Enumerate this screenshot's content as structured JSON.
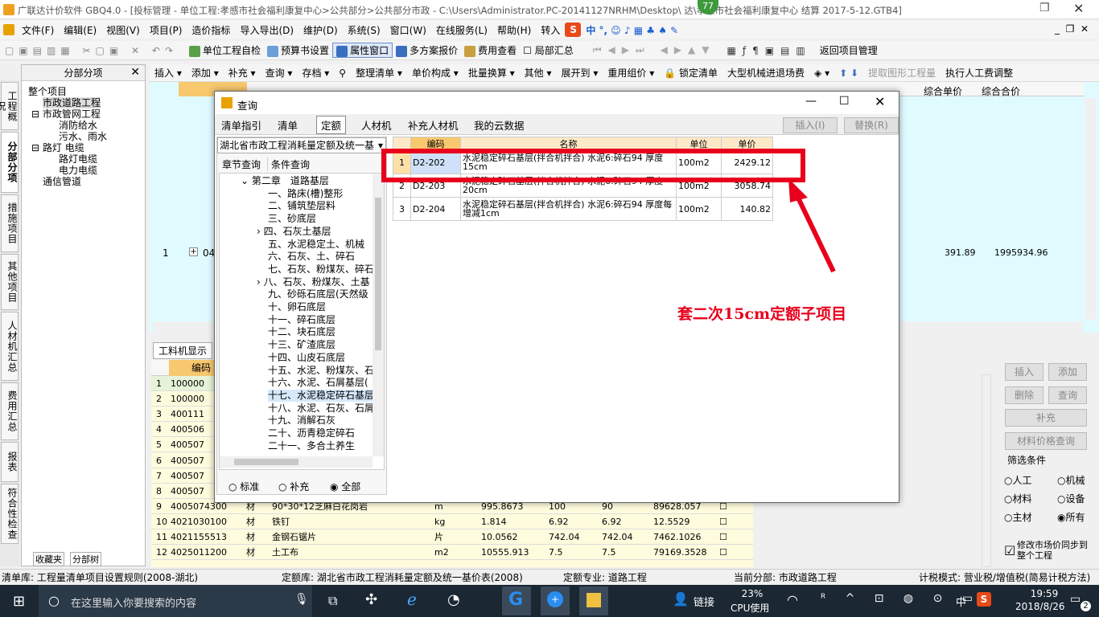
{
  "window": {
    "title": "广联达计价软件 GBQ4.0 - [投标管理 - 单位工程:孝感市社会福利康复中心>公共部分>公共部分市政 - C:\\Users\\Administrator.PC-20141127NRHM\\Desktop\\ 达\\孝感市社会福利康复中心 结算 2017-5-12.GTB4]",
    "badge": "77"
  },
  "menu": [
    "文件(F)",
    "编辑(E)",
    "视图(V)",
    "项目(P)",
    "造价指标",
    "导入导出(D)",
    "维护(D)",
    "系统(S)",
    "窗口(W)",
    "在线服务(L)",
    "帮助(H)",
    "转入"
  ],
  "toolbar1": [
    "单位工程自检",
    "预算书设置",
    "属性窗口",
    "多方案报价",
    "费用查看",
    "局部汇总",
    "返回项目管理"
  ],
  "left_tabs": [
    "工程概况",
    "分部分项",
    "措施项目",
    "其他项目",
    "人材机汇总",
    "费用汇总",
    "报表",
    "符合性检查"
  ],
  "tree": {
    "header": "分部分项",
    "nodes": [
      "整个项目",
      "市政道路工程",
      "市政管网工程",
      "消防给水",
      "污水、雨水",
      "路灯 电缆",
      "路灯电缆",
      "电力电缆",
      "通信管道"
    ],
    "footer_tabs": [
      "收藏夹",
      "分部树"
    ]
  },
  "toolbar2": [
    "插入",
    "添加",
    "补充",
    "查询",
    "存档",
    "整理清单",
    "单价构成",
    "批量换算",
    "其他",
    "展开到",
    "重用组价",
    "锁定清单",
    "大型机械进退场费",
    "提取图形工程量",
    "执行人工费调整"
  ],
  "maingrid": {
    "cols": [
      "综合单价",
      "综合合价"
    ],
    "row_no": "1",
    "code_prefix": "04(",
    "unit_price": "391.89",
    "total_price": "1995934.96"
  },
  "lower": {
    "tab": "工料机显示",
    "col_code": "编码",
    "rows": [
      [
        "1",
        "100000",
        "",
        "",
        "",
        "",
        "",
        ""
      ],
      [
        "2",
        "100000",
        "",
        "",
        "",
        "",
        "",
        ""
      ],
      [
        "3",
        "400111",
        "",
        "",
        "",
        "",
        "",
        ""
      ],
      [
        "4",
        "400506",
        "",
        "",
        "",
        "",
        "",
        ""
      ],
      [
        "5",
        "400507",
        "",
        "",
        "",
        "",
        "",
        ""
      ],
      [
        "6",
        "400507",
        "",
        "",
        "",
        "",
        "",
        ""
      ],
      [
        "7",
        "400507",
        "",
        "",
        "",
        "",
        "",
        ""
      ],
      [
        "8",
        "400507",
        "",
        "",
        "",
        "",
        "",
        ""
      ],
      [
        "9",
        "4005074300",
        "材",
        "90*30*12芝麻白花岗岩",
        "m",
        "995.8673",
        "100",
        "90",
        "89628.057"
      ],
      [
        "10",
        "4021030100",
        "材",
        "铁钉",
        "kg",
        "1.814",
        "6.92",
        "6.92",
        "12.5529"
      ],
      [
        "11",
        "4021155513",
        "材",
        "金钢石锯片",
        "片",
        "10.0562",
        "742.04",
        "742.04",
        "7462.1026"
      ],
      [
        "12",
        "4025011200",
        "材",
        "土工布",
        "m2",
        "10555.913",
        "7.5",
        "7.5",
        "79169.3528"
      ]
    ]
  },
  "rpanel": {
    "btns": [
      "插入",
      "添加",
      "删除",
      "查询",
      "补充",
      "材料价格查询"
    ],
    "filter_title": "筛选条件",
    "filters": [
      "人工",
      "机械",
      "材料",
      "设备",
      "主材",
      "所有"
    ],
    "sync": "修改市场价同步到整个工程"
  },
  "dialog": {
    "title": "查询",
    "tabs": [
      "清单指引",
      "清单",
      "定额",
      "人材机",
      "补充人材机",
      "我的云数据"
    ],
    "insert": "插入(I)",
    "replace": "替换(R)",
    "library": "湖北省市政工程消耗量定额及统一基",
    "subtabs": [
      "章节查询",
      "条件查询"
    ],
    "chapters": [
      "第二章　道路基层",
      "一、路床(槽)整形",
      "二、铺筑垫层料",
      "三、砂底层",
      "四、石灰土基层",
      "五、水泥稳定土、机械",
      "六、石灰、土、碎石",
      "七、石灰、粉煤灰、碎石",
      "八、石灰、粉煤灰、土基",
      "九、砂砾石底层(天然级",
      "十、卵石底层",
      "十一、碎石底层",
      "十二、块石底层",
      "十三、矿渣底层",
      "十四、山皮石底层",
      "十五、水泥、粉煤灰、石",
      "十六、水泥、石屑基层(",
      "十七、水泥稳定碎石基层",
      "十八、水泥、石灰、石屑",
      "十九、消解石灰",
      "二十、沥青稳定碎石",
      "二十一、多合土养生"
    ],
    "radios": [
      "标准",
      "补充",
      "全部"
    ],
    "grid_cols": [
      "编码",
      "名称",
      "单位",
      "单价"
    ],
    "rows": [
      [
        "1",
        "D2-202",
        "水泥稳定碎石基层(拌合机拌合) 水泥6:碎石94 厚度15cm",
        "100m2",
        "2429.12"
      ],
      [
        "2",
        "D2-203",
        "水泥稳定碎石基层(拌合机拌合) 水泥6:碎石94 厚度20cm",
        "100m2",
        "3058.74"
      ],
      [
        "3",
        "D2-204",
        "水泥稳定碎石基层(拌合机拌合) 水泥6:碎石94 厚度每增减1cm",
        "100m2",
        "140.82"
      ]
    ]
  },
  "annotation": "套二次15cm定额子项目",
  "status": {
    "qdk": "清单库: 工程量清单项目设置规则(2008-湖北)",
    "dek": "定额库: 湖北省市政工程消耗量定额及统一基价表(2008)",
    "dezy": "定额专业: 道路工程",
    "dqfb": "当前分部: 市政道路工程",
    "jsms": "计税模式: 营业税/增值税(简易计税方法)"
  },
  "taskbar": {
    "search": "在这里输入你要搜索的内容",
    "link": "链接",
    "cpu": "23%",
    "cpu_label": "CPU使用",
    "lang": "中",
    "time": "19:59",
    "date": "2018/8/26",
    "notif": "2"
  },
  "colors": {
    "annotation": "#e8001c",
    "main_grid": "#e0fbff",
    "lower_grid": "#fffbdd"
  }
}
